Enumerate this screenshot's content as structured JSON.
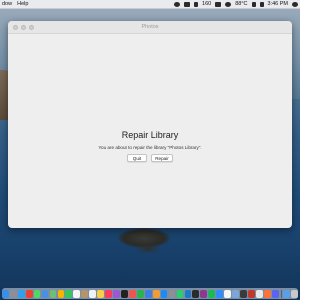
{
  "menubar": {
    "left_items": [
      {
        "label": "dow"
      },
      {
        "label": "Help"
      }
    ],
    "status": {
      "battery_label": "160",
      "temperature": "88°C",
      "time": "3:46 PM"
    }
  },
  "window": {
    "title": "Photos",
    "heading": "Repair Library",
    "message": "You are about to repair the library “Photos Library”.",
    "buttons": {
      "quit": "Quit",
      "repair": "Repair"
    }
  },
  "dock": {
    "icons": [
      {
        "name": "finder-icon",
        "color": "#3a8ee6"
      },
      {
        "name": "launchpad-icon",
        "color": "#8c8f99"
      },
      {
        "name": "safari-icon",
        "color": "#2f9ff0"
      },
      {
        "name": "chrome-icon",
        "color": "#e94235"
      },
      {
        "name": "messages-icon",
        "color": "#4cd964"
      },
      {
        "name": "mail-icon",
        "color": "#4a90e2"
      },
      {
        "name": "maps-icon",
        "color": "#6fbf73"
      },
      {
        "name": "photos-icon",
        "color": "#f4b400"
      },
      {
        "name": "facetime-icon",
        "color": "#34c759"
      },
      {
        "name": "calendar-icon",
        "color": "#f5f5f5"
      },
      {
        "name": "contacts-icon",
        "color": "#b5946a"
      },
      {
        "name": "reminders-icon",
        "color": "#f2f2f2"
      },
      {
        "name": "notes-icon",
        "color": "#f7d04a"
      },
      {
        "name": "music-icon",
        "color": "#fa3c5a"
      },
      {
        "name": "podcasts-icon",
        "color": "#9b59d0"
      },
      {
        "name": "tv-icon",
        "color": "#222222"
      },
      {
        "name": "news-icon",
        "color": "#f0544f"
      },
      {
        "name": "numbers-icon",
        "color": "#2fb24c"
      },
      {
        "name": "keynote-icon",
        "color": "#3b82e0"
      },
      {
        "name": "pages-icon",
        "color": "#f39c34"
      },
      {
        "name": "app-store-icon",
        "color": "#1c8cf5"
      },
      {
        "name": "system-preferences-icon",
        "color": "#8e8e93"
      },
      {
        "name": "whatsapp-icon",
        "color": "#25d366"
      },
      {
        "name": "vscode-icon",
        "color": "#1f7acb"
      },
      {
        "name": "terminal-icon",
        "color": "#2b2b2b"
      },
      {
        "name": "slack-icon",
        "color": "#8a3b8f"
      },
      {
        "name": "spotify-icon",
        "color": "#1db954"
      },
      {
        "name": "zoom-icon",
        "color": "#2d8cff"
      },
      {
        "name": "notion-icon",
        "color": "#f5f5f5"
      },
      {
        "name": "preview-icon",
        "color": "#7aa6d8"
      },
      {
        "name": "activity-monitor-icon",
        "color": "#3a3a3a"
      },
      {
        "name": "photo-booth-icon",
        "color": "#c0392b"
      },
      {
        "name": "textedit-icon",
        "color": "#e8e8e8"
      },
      {
        "name": "firefox-icon",
        "color": "#ff7139"
      },
      {
        "name": "discord-icon",
        "color": "#5865f2"
      }
    ],
    "trailing_icons": [
      {
        "name": "downloads-folder-icon",
        "color": "#5aa0e6"
      },
      {
        "name": "trash-icon",
        "color": "#c7c9cc"
      }
    ]
  }
}
